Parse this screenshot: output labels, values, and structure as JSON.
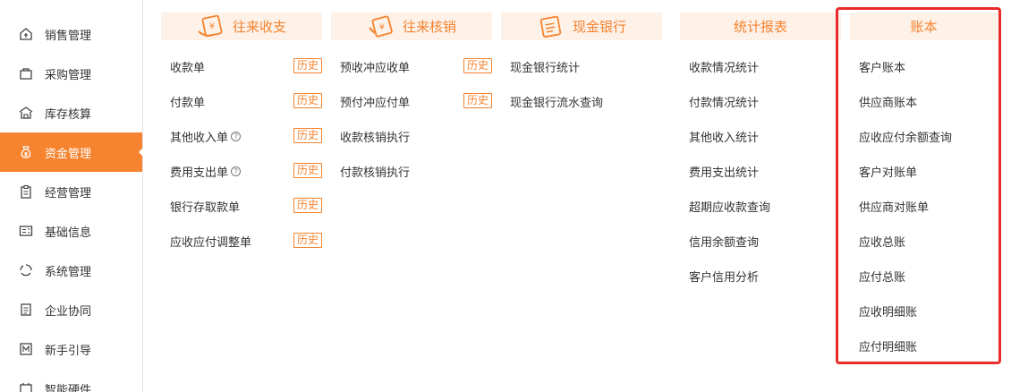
{
  "sidebar": {
    "items": [
      {
        "label": "销售管理",
        "icon": "sales-icon"
      },
      {
        "label": "采购管理",
        "icon": "purchase-bag-icon"
      },
      {
        "label": "库存核算",
        "icon": "warehouse-icon"
      },
      {
        "label": "资金管理",
        "icon": "money-bag-icon",
        "active": true
      },
      {
        "label": "经营管理",
        "icon": "clipboard-icon"
      },
      {
        "label": "基础信息",
        "icon": "id-card-icon"
      },
      {
        "label": "系统管理",
        "icon": "circle-dots-icon"
      },
      {
        "label": "企业协同",
        "icon": "document-icon"
      },
      {
        "label": "新手引导",
        "icon": "new-badge-icon"
      },
      {
        "label": "智能硬件",
        "icon": "hardware-icon"
      }
    ]
  },
  "columns": [
    {
      "title": "往来收支",
      "icon": "receipt-icon",
      "items": [
        {
          "label": "收款单",
          "badge": "历史"
        },
        {
          "label": "付款单",
          "badge": "历史"
        },
        {
          "label": "其他收入单",
          "help": "?",
          "badge": "历史"
        },
        {
          "label": "费用支出单",
          "help": "?",
          "badge": "历史"
        },
        {
          "label": "银行存取款单",
          "badge": "历史"
        },
        {
          "label": "应收应付调整单",
          "badge": "历史"
        }
      ]
    },
    {
      "title": "往来核销",
      "icon": "writeoff-icon",
      "items": [
        {
          "label": "预收冲应收单",
          "badge": "历史"
        },
        {
          "label": "预付冲应付单",
          "badge": "历史"
        },
        {
          "label": "收款核销执行"
        },
        {
          "label": "付款核销执行"
        }
      ]
    },
    {
      "title": "现金银行",
      "icon": "bank-doc-icon",
      "items": [
        {
          "label": "现金银行统计"
        },
        {
          "label": "现金银行流水查询"
        }
      ]
    },
    {
      "title": "统计报表",
      "items": [
        {
          "label": "收款情况统计"
        },
        {
          "label": "付款情况统计"
        },
        {
          "label": "其他收入统计"
        },
        {
          "label": "费用支出统计"
        },
        {
          "label": "超期应收款查询"
        },
        {
          "label": "信用余额查询"
        },
        {
          "label": "客户信用分析"
        }
      ]
    },
    {
      "title": "账本",
      "items": [
        {
          "label": "客户账本"
        },
        {
          "label": "供应商账本"
        },
        {
          "label": "应收应付余额查询"
        },
        {
          "label": "客户对账单"
        },
        {
          "label": "供应商对账单"
        },
        {
          "label": "应收总账"
        },
        {
          "label": "应付总账"
        },
        {
          "label": "应收明细账"
        },
        {
          "label": "应付明细账"
        }
      ]
    }
  ],
  "colors": {
    "accent": "#f5832f",
    "header_bg": "#fdf1e8",
    "highlight": "#e92a2a"
  }
}
